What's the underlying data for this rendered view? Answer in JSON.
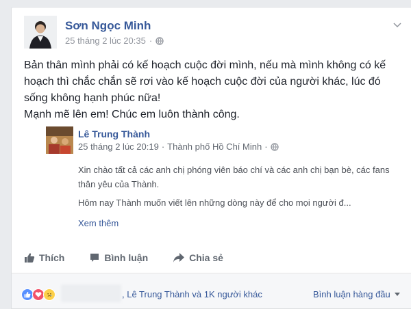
{
  "post": {
    "author": "Sơn Ngọc Minh",
    "timestamp": "25 tháng 2 lúc 20:35",
    "privacy_dot": "·",
    "text": "Bản thân mình phải có kế hoạch cuộc đời mình, nếu mà mình không có kế hoạch thì chắc chắn sẽ rơi vào kế hoạch cuộc đời của người khác, lúc đó sống không hạnh phúc nữa!",
    "text2": "Mạnh mẽ lên em! Chúc em luôn thành công."
  },
  "shared": {
    "author": "Lê Trung Thành",
    "timestamp": "25 tháng 2 lúc 20:19",
    "dot": "·",
    "location": "Thành phố Hồ Chí Minh",
    "dot2": "·",
    "p1": "Xin chào tất cả các anh chị phóng viên báo chí và các anh chị bạn bè, các fans thân yêu của Thành.",
    "p2": "Hôm nay Thành muốn viết lên những dòng này để cho mọi người đ...",
    "see_more": "Xem thêm"
  },
  "actions": {
    "like": "Thích",
    "comment": "Bình luận",
    "share": "Chia sẻ"
  },
  "footer": {
    "likes_text": ", Lê Trung Thành và 1K người khác",
    "sort": "Bình luận hàng đầu"
  },
  "colors": {
    "link": "#365899",
    "like_blue": "#5890ff",
    "love_red": "#f25268",
    "haha_yellow": "#fdd04a"
  }
}
